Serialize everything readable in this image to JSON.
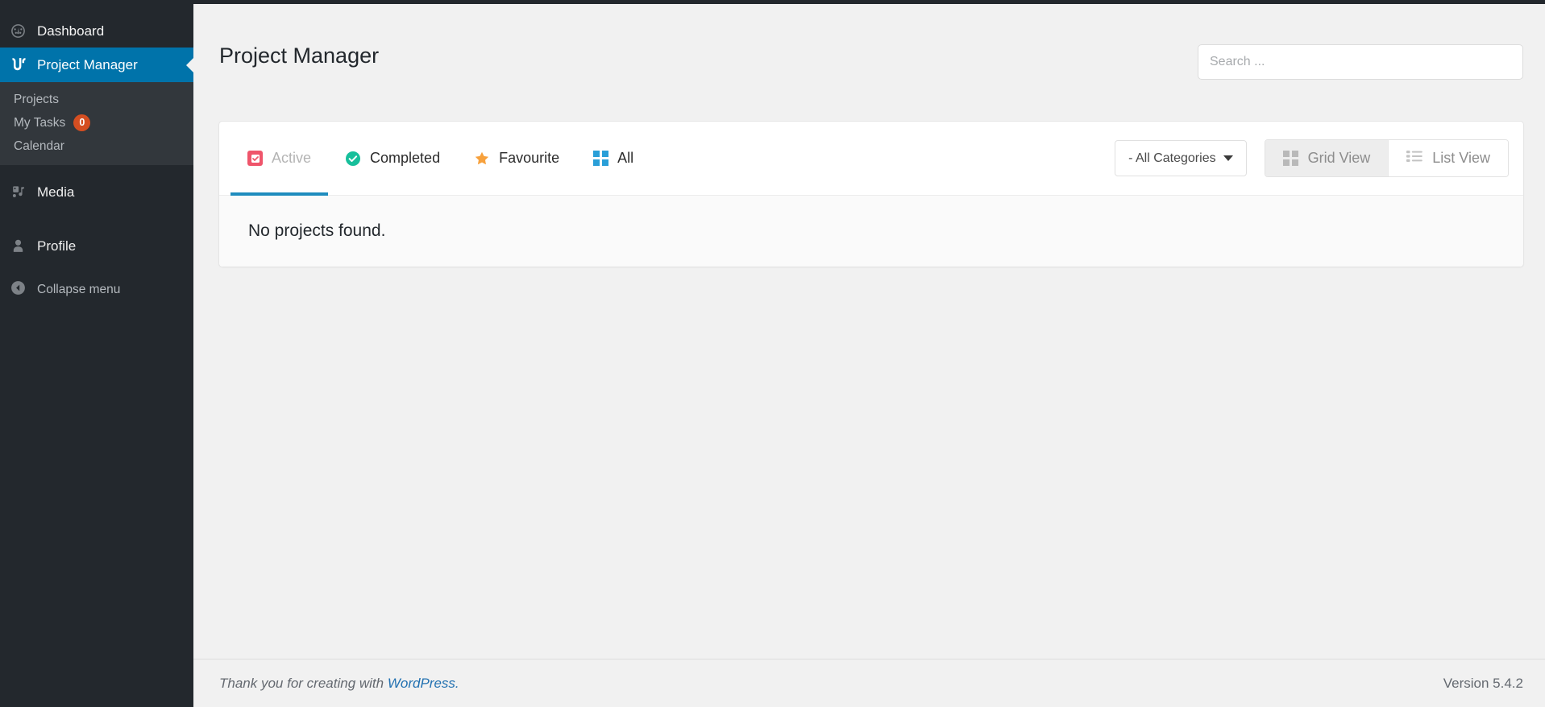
{
  "sidebar": {
    "dashboard": {
      "label": "Dashboard",
      "icon": "dashboard-gauge-icon"
    },
    "current": {
      "label": "Project Manager",
      "icon": "project-manager-icon"
    },
    "submenu": [
      {
        "label": "Projects",
        "badge": ""
      },
      {
        "label": "My Tasks",
        "badge": "0"
      },
      {
        "label": "Calendar",
        "badge": ""
      }
    ],
    "media": {
      "label": "Media",
      "icon": "media-icon"
    },
    "profile": {
      "label": "Profile",
      "icon": "user-icon"
    },
    "collapse": {
      "label": "Collapse menu",
      "icon": "collapse-arrow-icon"
    }
  },
  "header": {
    "title": "Project Manager",
    "search_placeholder": "Search ...",
    "search_value": ""
  },
  "toolbar": {
    "tabs": [
      {
        "label": "Active",
        "icon": "checkbox-checked-icon",
        "active": true
      },
      {
        "label": "Completed",
        "icon": "circle-check-icon",
        "active": false
      },
      {
        "label": "Favourite",
        "icon": "star-icon",
        "active": false
      },
      {
        "label": "All",
        "icon": "grid-icon",
        "active": false
      }
    ],
    "category_select": {
      "label": "- All Categories",
      "icon": "chevron-down-icon"
    },
    "views": [
      {
        "label": "Grid View",
        "icon": "grid-view-icon",
        "selected": true
      },
      {
        "label": "List View",
        "icon": "list-view-icon",
        "selected": false
      }
    ]
  },
  "main": {
    "empty_message": "No projects found."
  },
  "footer": {
    "thanks_prefix": "Thank you for creating with ",
    "link_label": "WordPress.",
    "version": "Version 5.4.2"
  },
  "colors": {
    "sidebar_bg": "#23282d",
    "submenu_bg": "#32373c",
    "accent_blue": "#0073aa",
    "tab_underline": "#1e8cbe",
    "badge_orange": "#d54e21",
    "active_icon_pink": "#ef556b",
    "completed_teal": "#17bf9b",
    "favourite_orange": "#f7a13c",
    "all_blue": "#2a9fd8",
    "link_blue": "#2271b1"
  }
}
